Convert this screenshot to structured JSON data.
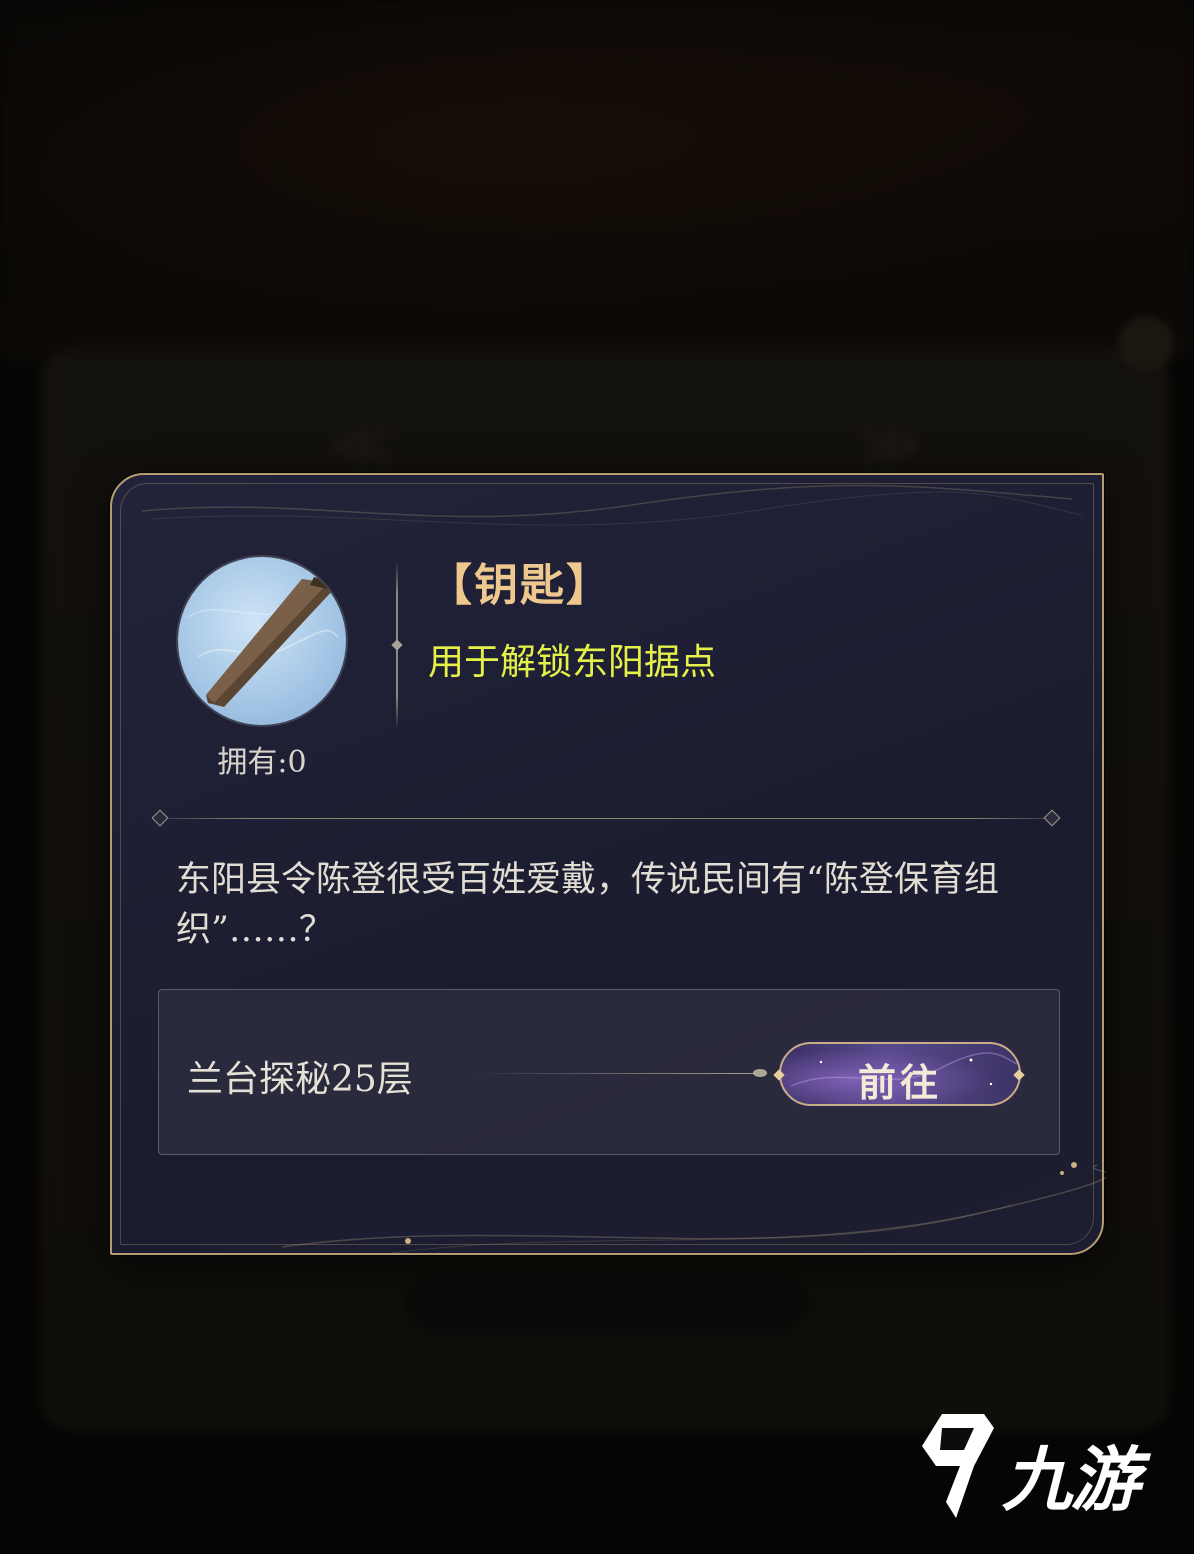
{
  "background": {
    "blurred_title": "",
    "arrow_left": "≪",
    "arrow_right": "≫"
  },
  "item": {
    "name": "【钥匙】",
    "usage": "用于解锁东阳据点",
    "owned_label": "拥有:0",
    "icon": "key-rod-icon",
    "description": "东阳县令陈登很受百姓爱戴，传说民间有“陈登保育组织”……？"
  },
  "source": {
    "label": "兰台探秘25层",
    "button_label": "前往"
  },
  "watermark": {
    "text": "九游",
    "logo": "9you-logo-icon"
  },
  "colors": {
    "dialog_bg": "#1f2034",
    "border_gold": "#b59c72",
    "title_gold": "#efc88f",
    "usage_yellow": "#e6f04a",
    "button_purple": "#4a3d78"
  }
}
